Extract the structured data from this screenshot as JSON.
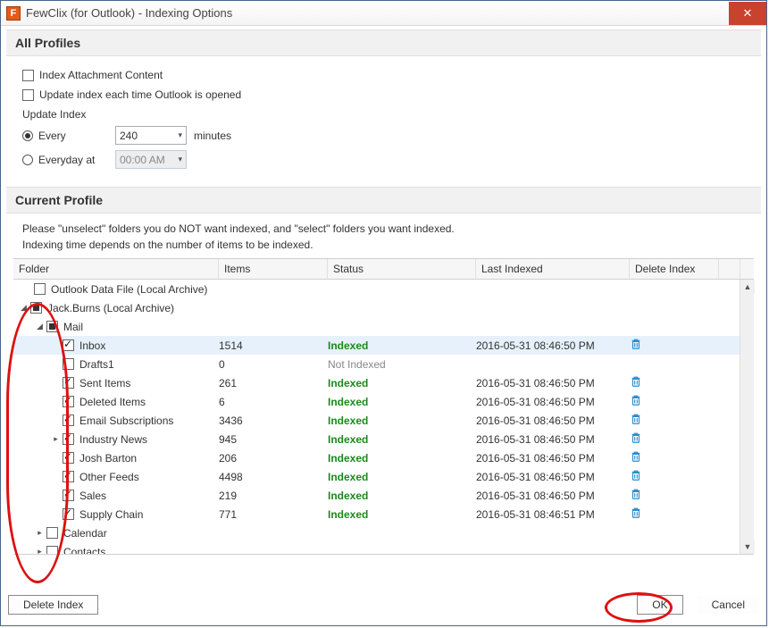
{
  "window": {
    "title": "FewClix (for Outlook) -  Indexing Options",
    "icon_letter": "F",
    "close_glyph": "✕"
  },
  "sections": {
    "all_profiles": "All Profiles",
    "current_profile": "Current Profile"
  },
  "checkboxes": {
    "index_attachment": "Index Attachment Content",
    "update_on_open": "Update index each time Outlook is opened"
  },
  "update_index": {
    "label": "Update Index",
    "every_label": "Every",
    "every_value": "240",
    "every_unit": "minutes",
    "everyday_label": "Everyday at",
    "everyday_value": "00:00 AM"
  },
  "notes": {
    "line1": "Please \"unselect\" folders you do NOT want indexed, and \"select\" folders you want indexed.",
    "line2": "Indexing time depends on the number of items to be indexed."
  },
  "columns": {
    "folder": "Folder",
    "items": "Items",
    "status": "Status",
    "last": "Last Indexed",
    "del": "Delete Index"
  },
  "tree": {
    "root1": {
      "name": "Outlook Data File  (Local Archive)"
    },
    "root2": {
      "name": "Jack.Burns  (Local Archive)"
    },
    "mail_label": "Mail",
    "rows": [
      {
        "name": "Inbox",
        "items": "1514",
        "status": "Indexed",
        "last": "2016-05-31 08:46:50 PM",
        "checked": true,
        "selected": true
      },
      {
        "name": "Drafts1",
        "items": "0",
        "status": "Not Indexed",
        "last": "",
        "checked": false
      },
      {
        "name": "Sent Items",
        "items": "261",
        "status": "Indexed",
        "last": "2016-05-31 08:46:50 PM",
        "checked": true
      },
      {
        "name": "Deleted Items",
        "items": "6",
        "status": "Indexed",
        "last": "2016-05-31 08:46:50 PM",
        "checked": true
      },
      {
        "name": "Email Subscriptions",
        "items": "3436",
        "status": "Indexed",
        "last": "2016-05-31 08:46:50 PM",
        "checked": true
      },
      {
        "name": "Industry News",
        "items": "945",
        "status": "Indexed",
        "last": "2016-05-31 08:46:50 PM",
        "checked": true,
        "expander": true
      },
      {
        "name": "Josh Barton",
        "items": "206",
        "status": "Indexed",
        "last": "2016-05-31 08:46:50 PM",
        "checked": true
      },
      {
        "name": "Other Feeds",
        "items": "4498",
        "status": "Indexed",
        "last": "2016-05-31 08:46:50 PM",
        "checked": true
      },
      {
        "name": "Sales",
        "items": "219",
        "status": "Indexed",
        "last": "2016-05-31 08:46:50 PM",
        "checked": true
      },
      {
        "name": "Supply Chain",
        "items": "771",
        "status": "Indexed",
        "last": "2016-05-31 08:46:51 PM",
        "checked": true
      }
    ],
    "calendar": "Calendar",
    "contacts": "Contacts"
  },
  "buttons": {
    "delete_index": "Delete Index",
    "ok": "OK",
    "cancel": "Cancel"
  }
}
